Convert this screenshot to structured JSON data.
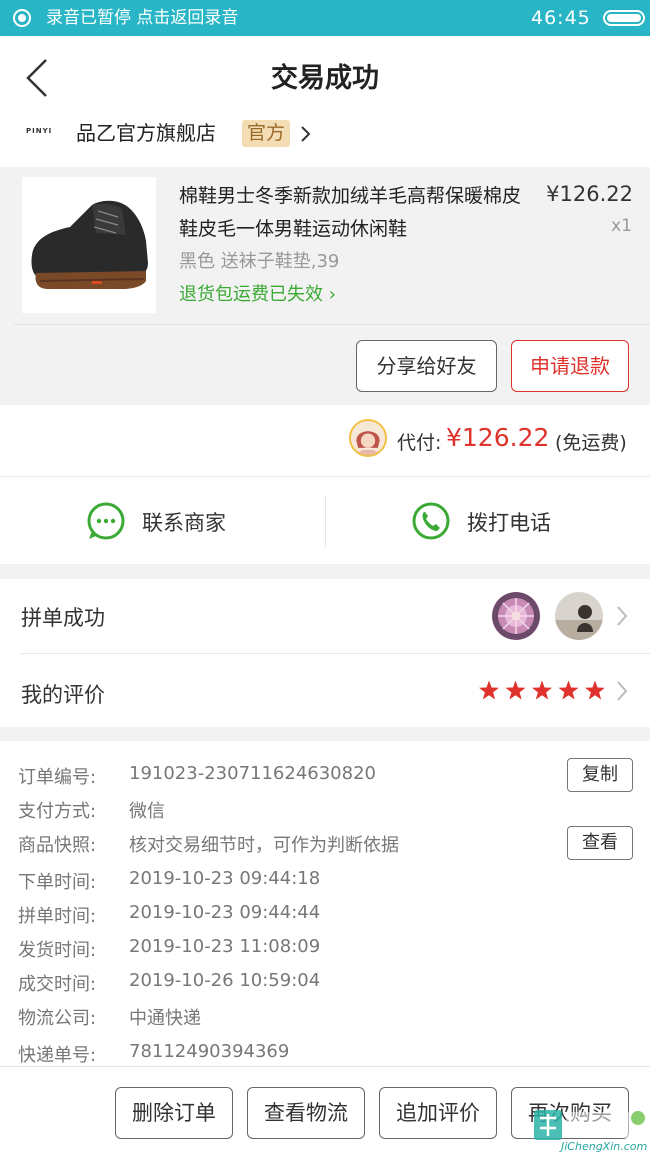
{
  "status_bar": {
    "recording_text": "录音已暂停    点击返回录音",
    "time": "46:45"
  },
  "header": {
    "title": "交易成功"
  },
  "store": {
    "logo_text": "PINYI",
    "name": "品乙官方旗舰店",
    "badge": "官方"
  },
  "product": {
    "title": "棉鞋男士冬季新款加绒羊毛高帮保暖棉皮鞋皮毛一体男鞋运动休闲鞋",
    "price": "¥126.22",
    "quantity": "x1",
    "sku": "黑色 送袜子鞋垫,39",
    "return_note": "退货包运费已失效",
    "share_button": "分享给好友",
    "refund_button": "申请退款"
  },
  "payment": {
    "label": "代付:",
    "amount": "¥126.22",
    "shipping": "(免运费)"
  },
  "contact": {
    "merchant_label": "联系商家",
    "call_label": "拨打电话"
  },
  "group_buy": {
    "label": "拼单成功"
  },
  "review": {
    "label": "我的评价",
    "stars": 5
  },
  "order_details": {
    "copy_button": "复制",
    "view_button": "查看",
    "rows": [
      {
        "label": "订单编号:",
        "value": "191023-230711624630820"
      },
      {
        "label": "支付方式:",
        "value": "微信"
      },
      {
        "label": "商品快照:",
        "value": "核对交易细节时，可作为判断依据"
      },
      {
        "label": "下单时间:",
        "value": "2019-10-23 09:44:18"
      },
      {
        "label": "拼单时间:",
        "value": "2019-10-23 09:44:44"
      },
      {
        "label": "发货时间:",
        "value": "2019-10-23 11:08:09"
      },
      {
        "label": "成交时间:",
        "value": "2019-10-26 10:59:04"
      },
      {
        "label": "物流公司:",
        "value": "中通快递"
      },
      {
        "label": "快递单号:",
        "value": "78112490394369"
      }
    ]
  },
  "bottom_actions": {
    "delete_order": "删除订单",
    "view_logistics": "查看物流",
    "add_review": "追加评价",
    "buy_again": "再次购买"
  },
  "watermark": {
    "text": "JiChengXin.com"
  },
  "colors": {
    "status_bar": "#28b6c6",
    "price_red": "#e0322c",
    "green": "#3aaa35",
    "badge_bg": "#f4ddb4"
  }
}
